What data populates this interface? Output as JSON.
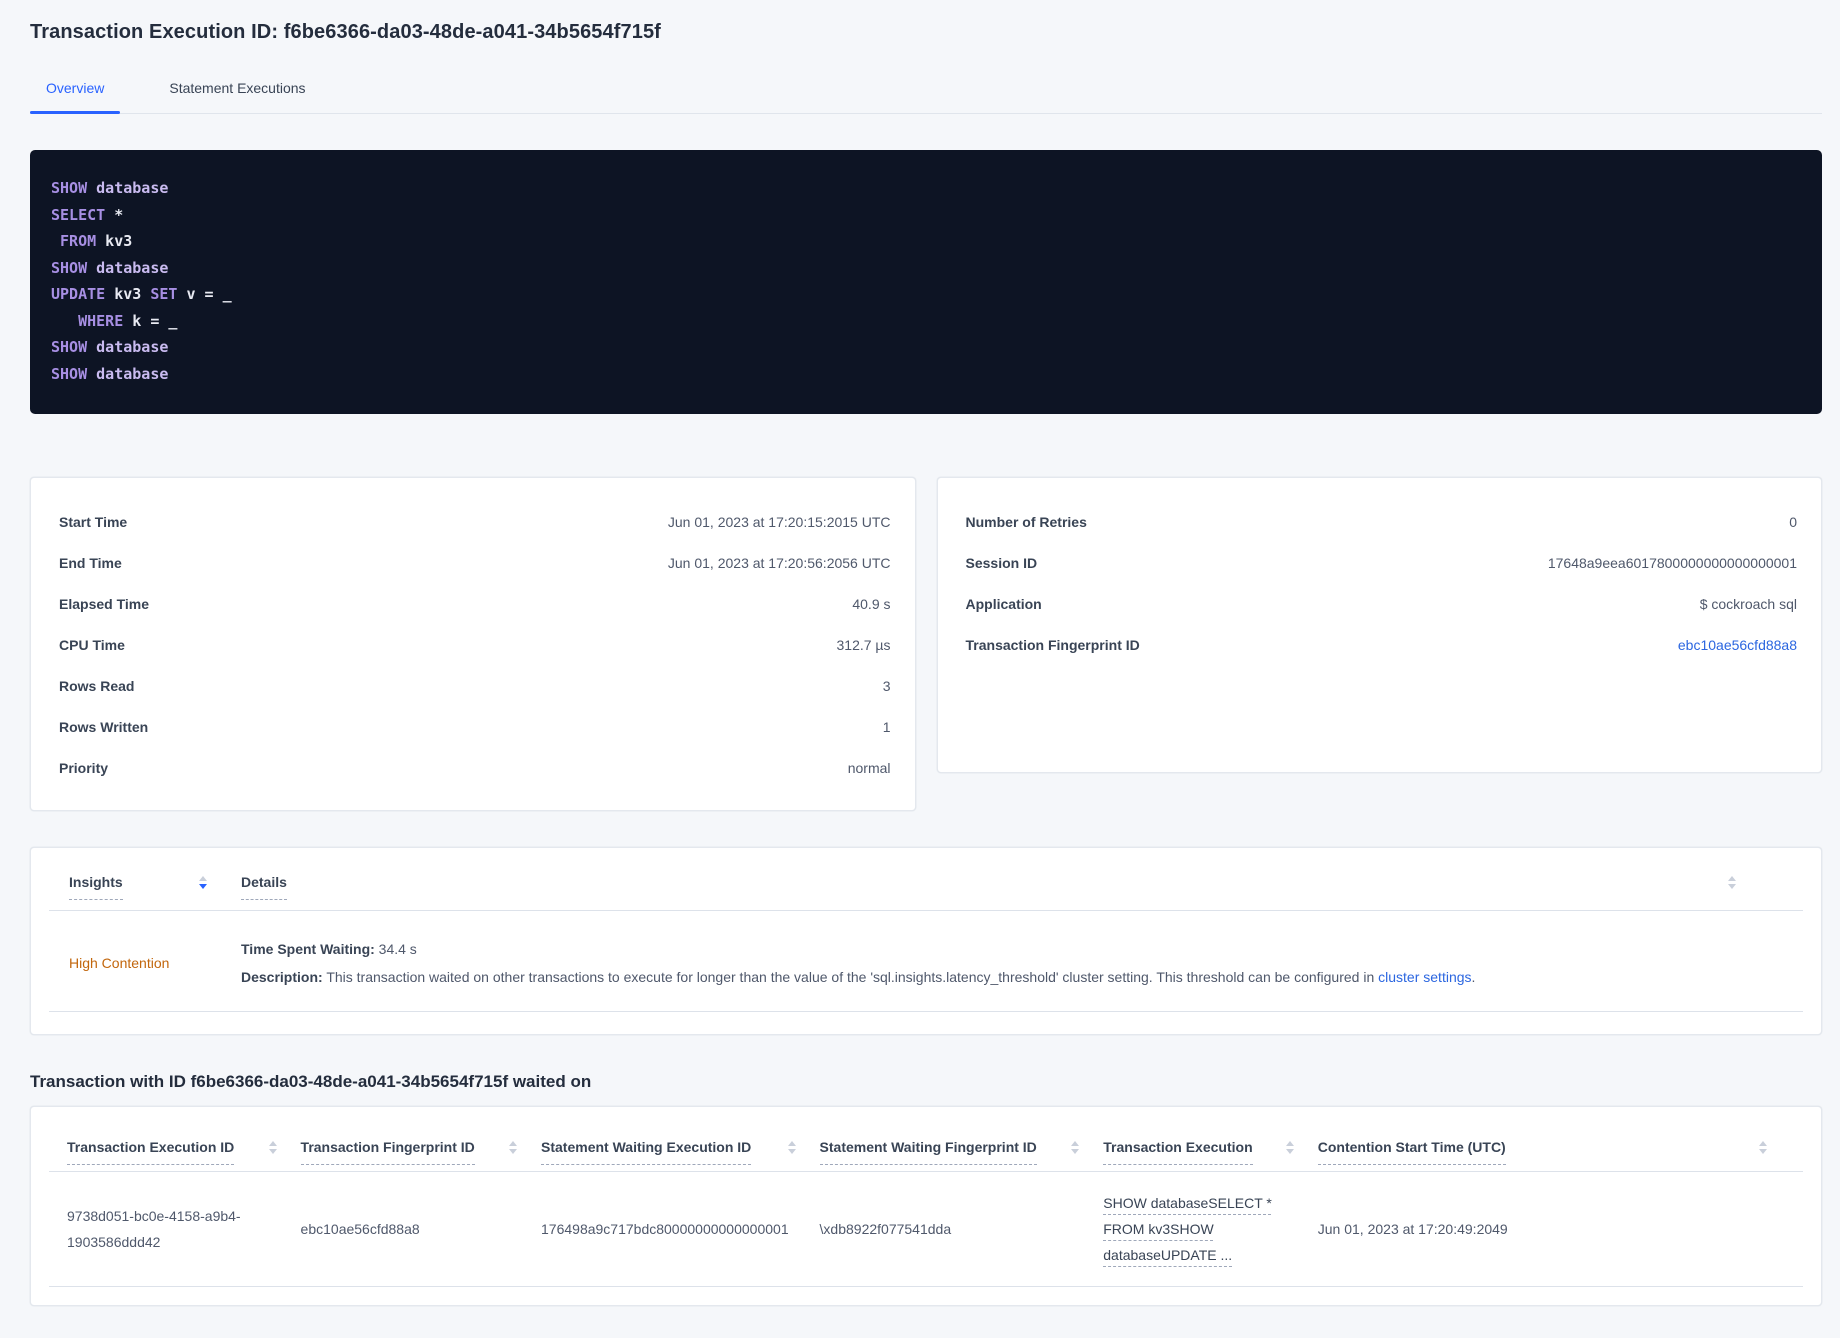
{
  "colors": {
    "accent": "#2962ff",
    "link": "#2b66e0",
    "insight_warning": "#c2660c",
    "sql_background": "#0d1424",
    "sql_keyword": "#a78fe3"
  },
  "page": {
    "title": "Transaction Execution ID: f6be6366-da03-48de-a041-34b5654f715f"
  },
  "tabs": [
    {
      "label": "Overview",
      "active": true
    },
    {
      "label": "Statement Executions",
      "active": false
    }
  ],
  "sql": {
    "lines": [
      [
        {
          "t": "kw",
          "v": "SHOW"
        },
        {
          "t": "pl",
          "v": " "
        },
        {
          "t": "id",
          "v": "database"
        }
      ],
      [
        {
          "t": "kw",
          "v": "SELECT"
        },
        {
          "t": "pl",
          "v": " *"
        }
      ],
      [
        {
          "t": "pl",
          "v": " "
        },
        {
          "t": "kw",
          "v": "FROM"
        },
        {
          "t": "pl",
          "v": " kv3"
        }
      ],
      [
        {
          "t": "kw",
          "v": "SHOW"
        },
        {
          "t": "pl",
          "v": " "
        },
        {
          "t": "id",
          "v": "database"
        }
      ],
      [
        {
          "t": "kw",
          "v": "UPDATE"
        },
        {
          "t": "pl",
          "v": " kv3 "
        },
        {
          "t": "kw",
          "v": "SET"
        },
        {
          "t": "pl",
          "v": " v = _"
        }
      ],
      [
        {
          "t": "pl",
          "v": "   "
        },
        {
          "t": "kw",
          "v": "WHERE"
        },
        {
          "t": "pl",
          "v": " k = _"
        }
      ],
      [
        {
          "t": "kw",
          "v": "SHOW"
        },
        {
          "t": "pl",
          "v": " "
        },
        {
          "t": "id",
          "v": "database"
        }
      ],
      [
        {
          "t": "kw",
          "v": "SHOW"
        },
        {
          "t": "pl",
          "v": " "
        },
        {
          "t": "id",
          "v": "database"
        }
      ]
    ]
  },
  "stats_card": {
    "rows": [
      {
        "label": "Start Time",
        "value": "Jun 01, 2023 at 17:20:15:2015 UTC"
      },
      {
        "label": "End Time",
        "value": "Jun 01, 2023 at 17:20:56:2056 UTC"
      },
      {
        "label": "Elapsed Time",
        "value": "40.9 s"
      },
      {
        "label": "CPU Time",
        "value": "312.7 µs"
      },
      {
        "label": "Rows Read",
        "value": "3"
      },
      {
        "label": "Rows Written",
        "value": "1"
      },
      {
        "label": "Priority",
        "value": "normal"
      }
    ]
  },
  "meta_card": {
    "rows": [
      {
        "label": "Number of Retries",
        "value": "0"
      },
      {
        "label": "Session ID",
        "value": "17648a9eea6017800000000000000001"
      },
      {
        "label": "Application",
        "value": "$ cockroach sql"
      },
      {
        "label": "Transaction Fingerprint ID",
        "value": "ebc10ae56cfd88a8",
        "link": true
      }
    ]
  },
  "insights": {
    "header": {
      "insights_label": "Insights",
      "details_label": "Details"
    },
    "row": {
      "name": "High Contention",
      "waiting_label": "Time Spent Waiting:",
      "waiting_value": "34.4 s",
      "desc_label": "Description:",
      "desc_text": "This transaction waited on other transactions to execute for longer than the value of the 'sql.insights.latency_threshold' cluster setting. This threshold can be configured in ",
      "desc_link": "cluster settings",
      "desc_period": "."
    }
  },
  "waited": {
    "title": "Transaction with ID f6be6366-da03-48de-a041-34b5654f715f waited on",
    "columns": [
      "Transaction Execution ID",
      "Transaction Fingerprint ID",
      "Statement Waiting Execution ID",
      "Statement Waiting Fingerprint ID",
      "Transaction Execution",
      "Contention Start Time (UTC)"
    ],
    "row": {
      "transaction_execution_id": "9738d051-bc0e-4158-a9b4-1903586ddd42",
      "transaction_fingerprint_id": "ebc10ae56cfd88a8",
      "statement_waiting_execution_id": "176498a9c717bdc80000000000000001",
      "statement_waiting_fingerprint_id": "\\xdb8922f077541dda",
      "transaction_execution": "SHOW databaseSELECT * FROM kv3SHOW databaseUPDATE ...",
      "contention_start_time": "Jun 01, 2023 at 17:20:49:2049"
    }
  }
}
